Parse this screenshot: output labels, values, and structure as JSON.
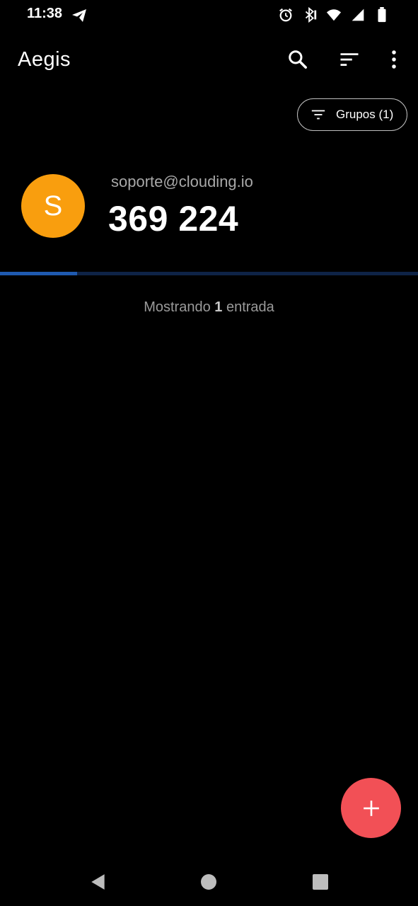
{
  "status_bar": {
    "time": "11:38",
    "icons": [
      "telegram-icon",
      "alarm-icon",
      "bluetooth-icon",
      "vibrate-icon",
      "wifi-icon",
      "signal-icon",
      "battery-icon"
    ]
  },
  "app_bar": {
    "title": "Aegis",
    "actions": [
      "search-icon",
      "sort-icon",
      "more-vert-icon"
    ]
  },
  "groups_chip": {
    "label": "Grupos (1)"
  },
  "entries": [
    {
      "avatar_letter": "S",
      "avatar_color": "#f99e0e",
      "issuer": "soporte@clouding.io",
      "code": "369 224",
      "progress": 0.185
    }
  ],
  "entry_count": {
    "prefix": "Mostrando",
    "count": "1",
    "suffix": "entrada"
  },
  "fab": {
    "icon": "plus-icon",
    "color": "#f25056"
  },
  "nav_bar": {
    "buttons": [
      "back-icon",
      "home-icon",
      "recents-icon"
    ]
  }
}
